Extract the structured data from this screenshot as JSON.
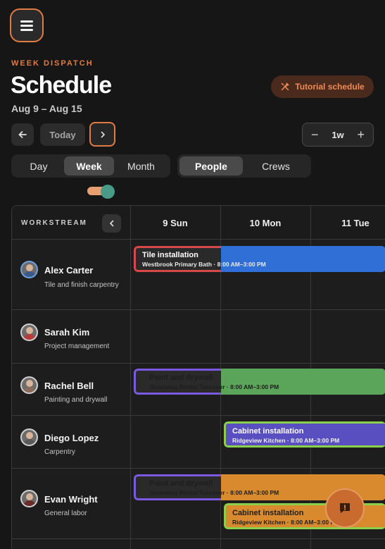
{
  "header": {
    "eyebrow": "WEEK DISPATCH",
    "title": "Schedule",
    "date_range": "Aug 9 – Aug 15",
    "tutorial_label": "Tutorial schedule"
  },
  "nav": {
    "today_label": "Today",
    "zoom_value": "1w",
    "zoom_minus": "−",
    "zoom_plus": "+"
  },
  "view_tabs": [
    {
      "label": "Day",
      "active": false
    },
    {
      "label": "Week",
      "active": true
    },
    {
      "label": "Month",
      "active": false
    }
  ],
  "group_tabs": [
    {
      "label": "People",
      "active": true
    },
    {
      "label": "Crews",
      "active": false
    }
  ],
  "grid": {
    "workstream_header": "WORKSTREAM",
    "days": [
      "9 Sun",
      "10 Mon",
      "11 Tue"
    ]
  },
  "people": [
    {
      "name": "Alex Carter",
      "role": "Tile and finish carpentry"
    },
    {
      "name": "Sarah Kim",
      "role": "Project management"
    },
    {
      "name": "Rachel Bell",
      "role": "Painting and drywall"
    },
    {
      "name": "Diego Lopez",
      "role": "Carpentry"
    },
    {
      "name": "Evan Wright",
      "role": "General labor"
    }
  ],
  "events": [
    {
      "title": "Tile installation",
      "subtitle": "Westbrook Primary Bath · 8:00 AM–3:00 PM",
      "color": "#2f6fd6",
      "accent": "#d94848"
    },
    {
      "title": "Paint and drywall",
      "subtitle": "Greenway Rental Turnover · 8:00 AM–3:00 PM",
      "color": "#5aa55a",
      "accent": "#7a5ae0"
    },
    {
      "title": "Cabinet installation",
      "subtitle": "Ridgeview Kitchen · 8:00 AM–3:00 PM",
      "color": "#5a4fc0",
      "accent": "#8ad04a"
    },
    {
      "title": "Paint and drywall",
      "subtitle": "Greenway Rental Turnover · 8:00 AM–3:00 PM",
      "color": "#d98a2e",
      "accent": "#7a5ae0"
    },
    {
      "title": "Cabinet installation",
      "subtitle": "Ridgeview Kitchen · 8:00 AM–3:00 PM",
      "color": "#d98a2e",
      "accent": "#8ad04a"
    }
  ],
  "colors": {
    "accent": "#e07b45",
    "background": "#161616"
  },
  "icons": {
    "menu": "menu-icon",
    "tutorial": "tools-icon",
    "prev": "arrow-left-icon",
    "next": "chevron-right-icon",
    "collapse": "chevron-left-icon",
    "fab": "feedback-icon"
  }
}
